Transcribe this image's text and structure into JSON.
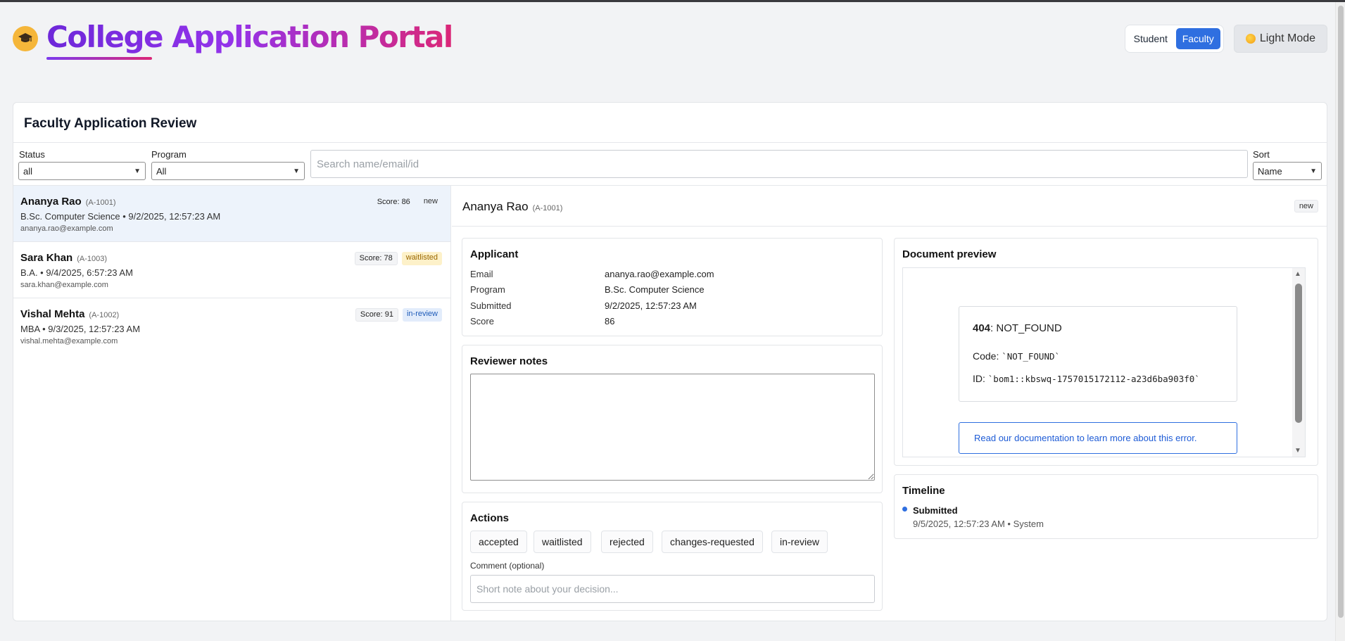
{
  "header": {
    "title": "College Application Portal",
    "logo_icon": "graduation-cap-icon",
    "roles": [
      "Student",
      "Faculty"
    ],
    "active_role": "Faculty",
    "theme_label": "Light Mode",
    "theme_icon": "sun-icon"
  },
  "review": {
    "title": "Faculty Application Review",
    "filters": {
      "status_label": "Status",
      "status_value": "all",
      "program_label": "Program",
      "program_value": "All",
      "search_placeholder": "Search name/email/id",
      "sort_label": "Sort",
      "sort_value": "Name"
    }
  },
  "applicants": [
    {
      "name": "Ananya Rao",
      "id": "(A-1001)",
      "sub": "B.Sc. Computer Science • 9/2/2025, 12:57:23 AM",
      "email": "ananya.rao@example.com",
      "score": "Score: 86",
      "status": "new"
    },
    {
      "name": "Sara Khan",
      "id": "(A-1003)",
      "sub": "B.A. • 9/4/2025, 6:57:23 AM",
      "email": "sara.khan@example.com",
      "score": "Score: 78",
      "status": "waitlisted"
    },
    {
      "name": "Vishal Mehta",
      "id": "(A-1002)",
      "sub": "MBA • 9/3/2025, 12:57:23 AM",
      "email": "vishal.mehta@example.com",
      "score": "Score: 91",
      "status": "in-review"
    }
  ],
  "detail": {
    "name": "Ananya Rao",
    "id": "(A-1001)",
    "status": "new",
    "applicant": {
      "title": "Applicant",
      "fields": [
        {
          "label": "Email",
          "value": "ananya.rao@example.com"
        },
        {
          "label": "Program",
          "value": "B.Sc. Computer Science"
        },
        {
          "label": "Submitted",
          "value": "9/2/2025, 12:57:23 AM"
        },
        {
          "label": "Score",
          "value": "86"
        }
      ]
    },
    "notes": {
      "title": "Reviewer notes",
      "value": ""
    },
    "actions": {
      "title": "Actions",
      "buttons": [
        "accepted",
        "waitlisted",
        "rejected",
        "changes-requested",
        "in-review"
      ],
      "comment_label": "Comment (optional)",
      "comment_placeholder": "Short note about your decision..."
    },
    "preview": {
      "title": "Document preview",
      "error_code": "404",
      "error_title": ": NOT_FOUND",
      "code_label": "Code: ",
      "code_value": "`NOT_FOUND`",
      "id_label": "ID: ",
      "id_value": "`bom1::kbswq-1757015172112-a23d6ba903f0`",
      "doc_link": "Read our documentation to learn more about this error."
    },
    "timeline": {
      "title": "Timeline",
      "events": [
        {
          "title": "Submitted",
          "meta": "9/5/2025, 12:57:23 AM • System"
        }
      ]
    }
  }
}
